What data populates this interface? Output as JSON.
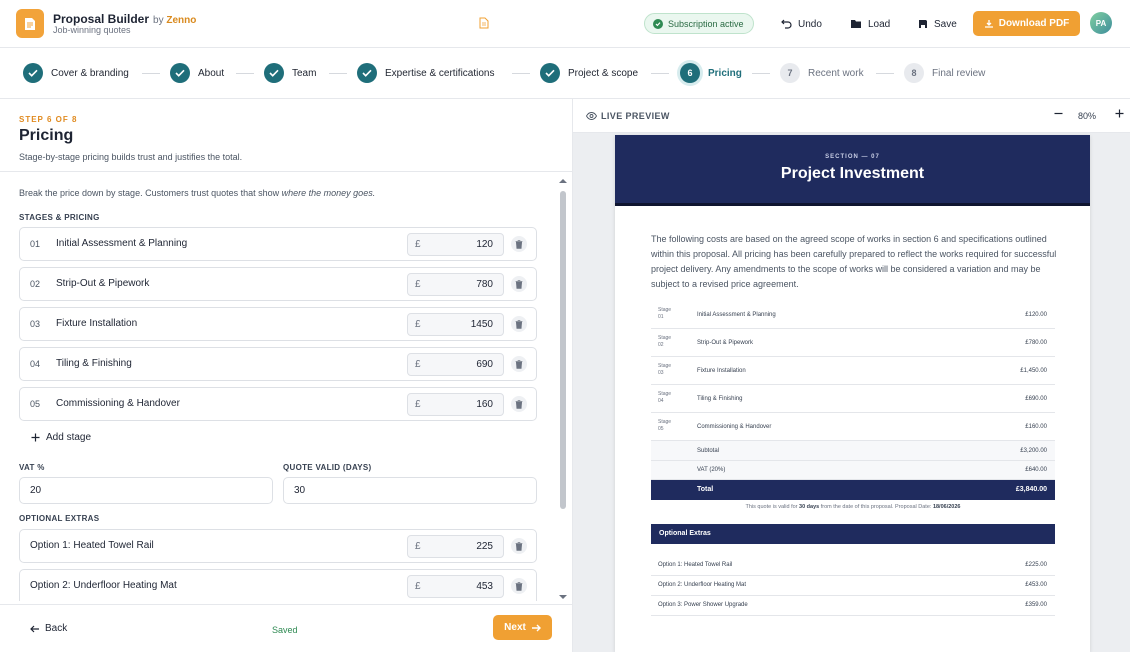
{
  "header": {
    "app_name": "Proposal Builder",
    "by_label": "by",
    "brand": "Zenno",
    "tagline": "Job-winning quotes",
    "subscription_status": "Subscription active",
    "undo_label": "Undo",
    "load_label": "Load",
    "save_label": "Save",
    "download_label": "Download PDF",
    "avatar_initials": "PA",
    "accent_color": "#f0a033"
  },
  "stepper": {
    "steps": [
      {
        "label": "Cover & branding",
        "state": "done"
      },
      {
        "label": "About",
        "state": "done"
      },
      {
        "label": "Team",
        "state": "done"
      },
      {
        "label": "Expertise & certifications",
        "state": "done"
      },
      {
        "label": "Project & scope",
        "state": "done"
      },
      {
        "number": "6",
        "label": "Pricing",
        "state": "current"
      },
      {
        "number": "7",
        "label": "Recent work",
        "state": "todo"
      },
      {
        "number": "8",
        "label": "Final review",
        "state": "todo"
      }
    ]
  },
  "form": {
    "step_counter": "STEP 6 OF 8",
    "title": "Pricing",
    "subtitle": "Stage-by-stage pricing builds trust and justifies the total.",
    "intro_text": "Break the price down by stage. Customers trust quotes that show ",
    "intro_emphasis": "where the money goes.",
    "stages_label": "STAGES & PRICING",
    "currency_symbol": "£",
    "stages": [
      {
        "num": "01",
        "name": "Initial Assessment & Planning",
        "price": "120"
      },
      {
        "num": "02",
        "name": "Strip-Out & Pipework",
        "price": "780"
      },
      {
        "num": "03",
        "name": "Fixture Installation",
        "price": "1450"
      },
      {
        "num": "04",
        "name": "Tiling & Finishing",
        "price": "690"
      },
      {
        "num": "05",
        "name": "Commissioning & Handover",
        "price": "160"
      }
    ],
    "add_stage_label": "Add stage",
    "vat_label": "VAT %",
    "vat_value": "20",
    "valid_label": "QUOTE VALID (DAYS)",
    "valid_value": "30",
    "extras_label": "OPTIONAL EXTRAS",
    "extras": [
      {
        "name": "Option 1: Heated Towel Rail",
        "price": "225"
      },
      {
        "name": "Option 2: Underfloor Heating Mat",
        "price": "453"
      }
    ],
    "back_label": "Back",
    "saved_status": "Saved",
    "next_label": "Next"
  },
  "preview": {
    "label": "LIVE PREVIEW",
    "zoom": "80%",
    "section_label": "SECTION — 07",
    "title": "Project Investment",
    "paragraph": "The following costs are based on the agreed scope of works in section 6 and specifications outlined within this proposal. All pricing has been carefully prepared to reflect the works required for successful project delivery. Any amendments to the scope of works will be considered a variation and may be subject to a revised price agreement.",
    "stage_word": "Stage",
    "rows": [
      {
        "num": "01",
        "name": "Initial Assessment & Planning",
        "amount": "£120.00"
      },
      {
        "num": "02",
        "name": "Strip-Out & Pipework",
        "amount": "£780.00"
      },
      {
        "num": "03",
        "name": "Fixture Installation",
        "amount": "£1,450.00"
      },
      {
        "num": "04",
        "name": "Tiling & Finishing",
        "amount": "£690.00"
      },
      {
        "num": "05",
        "name": "Commissioning & Handover",
        "amount": "£160.00"
      }
    ],
    "subtotal_label": "Subtotal",
    "subtotal": "£3,200.00",
    "vat_label": "VAT (20%)",
    "vat": "£640.00",
    "total_label": "Total",
    "total": "£3,840.00",
    "note_pre": "This quote is valid for ",
    "note_days": "30 days",
    "note_mid": " from the date of this proposal. Proposal Date: ",
    "note_date": "18/06/2026",
    "extras_title": "Optional Extras",
    "extras": [
      {
        "name": "Option 1: Heated Towel Rail",
        "amount": "£225.00"
      },
      {
        "name": "Option 2: Underfloor Heating Mat",
        "amount": "£453.00"
      },
      {
        "name": "Option 3: Power Shower Upgrade",
        "amount": "£359.00"
      }
    ],
    "navy_color": "#1f2b5e"
  }
}
